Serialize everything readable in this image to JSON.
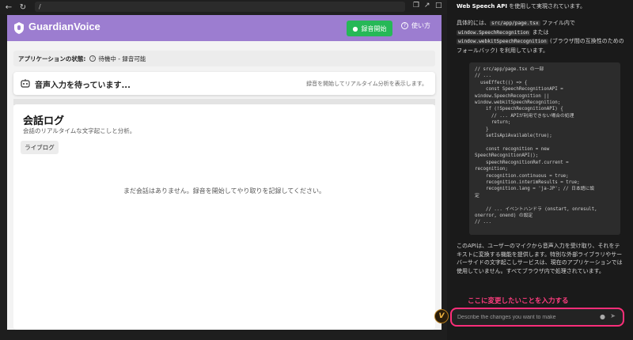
{
  "browser": {
    "back_icon": "arrow-left-icon",
    "reload_icon": "reload-icon",
    "url": "/",
    "icons": [
      "copy-icon",
      "open-external-icon",
      "maximize-icon"
    ]
  },
  "app": {
    "name": "GuardianVoice",
    "record_label": "録音開始",
    "help_label": "使い方",
    "accent": "#9c7dd0",
    "record_color": "#26b857"
  },
  "status": {
    "label": "アプリケーションの状態:",
    "value": "待機中 - 録音可能"
  },
  "voice": {
    "title": "音声入力を待っています...",
    "hint": "録音を開始してリアルタイム分析を表示します。"
  },
  "log": {
    "title": "会話ログ",
    "subtitle": "会話のリアルタイムな文字起こしと分析。",
    "live_label": "ライブログ",
    "empty": "まだ会話はありません。録音を開始してやり取りを記録してください。"
  },
  "panel": {
    "line1_bold": "Web Speech API",
    "line1_rest": " を使用して実現されています。",
    "para1_a": "具体的には、",
    "para1_code1": "src/app/page.tsx",
    "para1_b": " ファイル内で ",
    "para1_code2": "window.SpeechRecognition",
    "para1_c": " または ",
    "para1_code3": "window.webkitSpeechRecognition",
    "para1_d": " (ブラウザ間の互換性のためのフォールバック) を利用しています。",
    "code": "// src/app/page.tsx の一部\n// ...\n  useEffect(() => {\n    const SpeechRecognitionAPI =\nwindow.SpeechRecognition ||\nwindow.webkitSpeechRecognition;\n    if (!SpeechRecognitionAPI) {\n      // ... APIが利用できない場合の処理\n      return;\n    }\n    setIsApiAvailable(true);\n\n    const recognition = new\nSpeechRecognitionAPI();\n    speechRecognitionRef.current =\nrecognition;\n    recognition.continuous = true;\n    recognition.interimResults = true;\n    recognition.lang = 'ja-JP'; // 日本語に設\n定\n\n    // ... イベントハンドラ (onstart, onresult,\nonerror, onend) の設定\n// ...",
    "para2": "このAPIは、ユーザーのマイクから音声入力を受け取り、それをテキストに変換する機能を提供します。特別な外部ライブラリやサーバーサイドの文字起こしサービスは、現在のアプリケーションでは使用していません。すべてブラウザ内で処理されています。"
  },
  "annotation": "ここに変更したいことを入力する",
  "chat": {
    "placeholder": "Describe the changes you want to make",
    "highlight": "#ff2e79"
  },
  "agent_avatar_letter": "V"
}
